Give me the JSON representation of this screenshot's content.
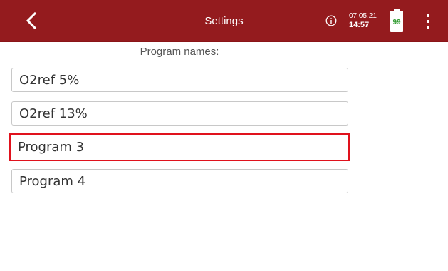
{
  "header": {
    "title": "Settings",
    "date": "07.05.21",
    "time": "14:57",
    "battery_level": "99",
    "back_icon": "chevron-left-icon",
    "info_icon": "info-circle-icon",
    "menu_icon": "more-vertical-icon",
    "bar_color": "#941b1e",
    "battery_text_color": "#2e9a2e"
  },
  "main": {
    "section_label": "Program names:",
    "programs": [
      {
        "value": "O2ref 5%"
      },
      {
        "value": "O2ref 13%"
      },
      {
        "value": "Program 3",
        "focused": true,
        "highlight_color": "#e0121d"
      },
      {
        "value": "Program 4"
      }
    ]
  }
}
